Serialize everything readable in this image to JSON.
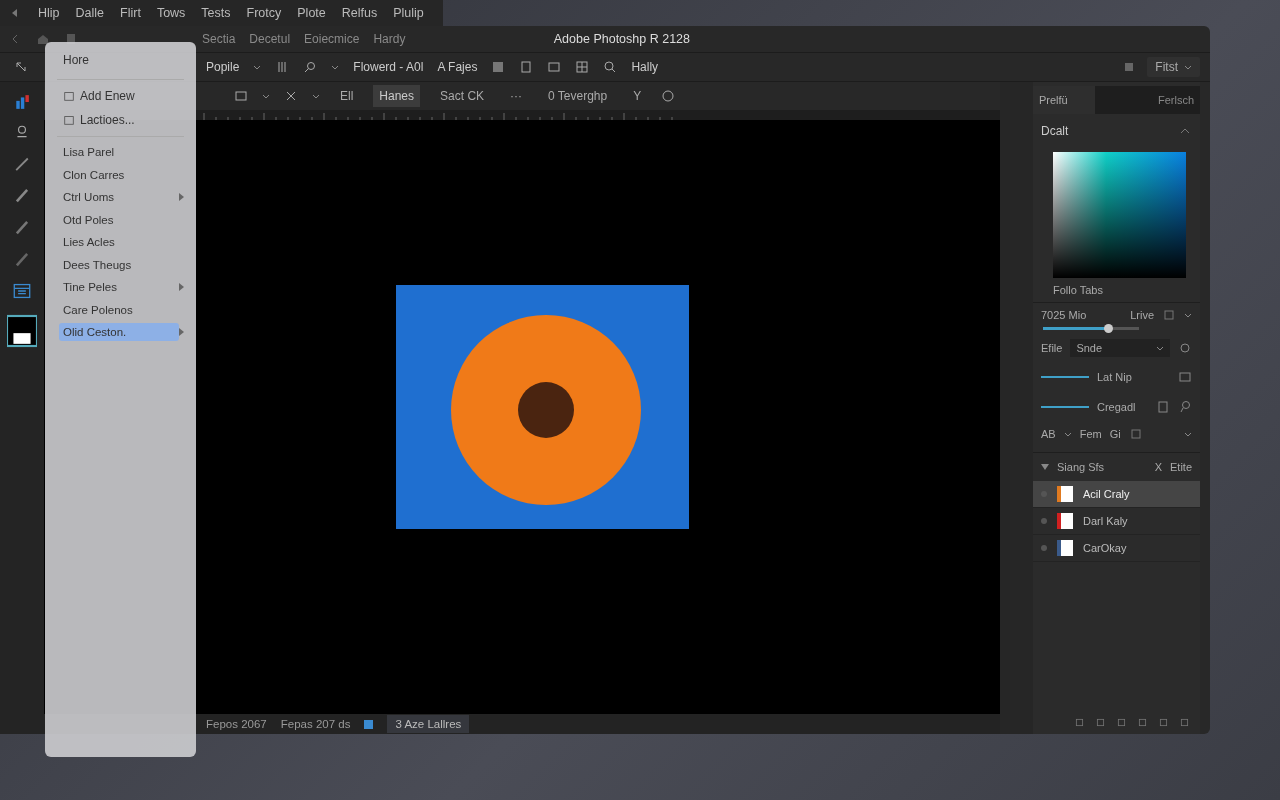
{
  "menubar": {
    "items": [
      "Hlip",
      "Dalle",
      "Flirt",
      "Tows",
      "Tests",
      "Frotcy",
      "Plote",
      "Relfus",
      "Plulip"
    ]
  },
  "window": {
    "title": "Adobe Photoshp R 2128",
    "tabs": [
      "Sectia",
      "Decetul",
      "Eoiecmice",
      "Hardy"
    ]
  },
  "options_bar": {
    "preset": "Popile",
    "document": "Flowerd - A0l",
    "fonts": "A Fajes",
    "user": "Hally",
    "workspace": "Fitst"
  },
  "toolbar": {
    "items": [
      {
        "label": "Ell",
        "selected": false
      },
      {
        "label": "Hanes",
        "selected": true
      },
      {
        "label": "Sact CK",
        "selected": false
      },
      {
        "label": "···",
        "selected": false
      },
      {
        "label": "0 Teverghp",
        "selected": false
      },
      {
        "label": "Y",
        "selected": false
      }
    ]
  },
  "context_menu": {
    "header": "Hore",
    "actions": [
      "Add Enew",
      "Lactioes..."
    ],
    "items": [
      {
        "label": "Lisa Parel",
        "submenu": false,
        "selected": false
      },
      {
        "label": "Clon Carres",
        "submenu": false,
        "selected": false
      },
      {
        "label": "Ctrl Uoms",
        "submenu": true,
        "selected": false
      },
      {
        "label": "Otd Poles",
        "submenu": false,
        "selected": false
      },
      {
        "label": "Lies Acles",
        "submenu": false,
        "selected": false
      },
      {
        "label": "Dees Theugs",
        "submenu": false,
        "selected": false
      },
      {
        "label": "Tine Peles",
        "submenu": true,
        "selected": false
      },
      {
        "label": "Care Polenos",
        "submenu": false,
        "selected": false
      },
      {
        "label": "Olid Ceston.",
        "submenu": true,
        "selected": true
      }
    ]
  },
  "right_panel": {
    "tabs": [
      {
        "label": "Prelfü",
        "selected": true
      },
      {
        "label": "Ferlsch",
        "selected": false
      }
    ],
    "section": "Dcalt",
    "swatch_label": "Follo Tabs",
    "size": {
      "label": "7025 Mio",
      "mode": "Lrive",
      "level": 0.68
    },
    "style": {
      "label": "Efile",
      "value": "Snde"
    },
    "stroke_rows": [
      "Lat Nip",
      "Cregadl"
    ],
    "font_row": {
      "size": "AB",
      "font": "Fem",
      "weight": "Gi"
    },
    "layers": {
      "title": "Siang Sfs",
      "close": "X",
      "edit": "Etite",
      "items": [
        {
          "name": "Acil Craly",
          "selected": true,
          "color": "#e07a20"
        },
        {
          "name": "Darl Kaly",
          "selected": false,
          "color": "#d02020"
        },
        {
          "name": "CarOkay",
          "selected": false,
          "color": "#3a5a8a"
        }
      ]
    }
  },
  "status_bar": {
    "items": [
      "Fepos 2067",
      "Fepas 207 ds"
    ],
    "layers": "3 Aze Lallres"
  }
}
